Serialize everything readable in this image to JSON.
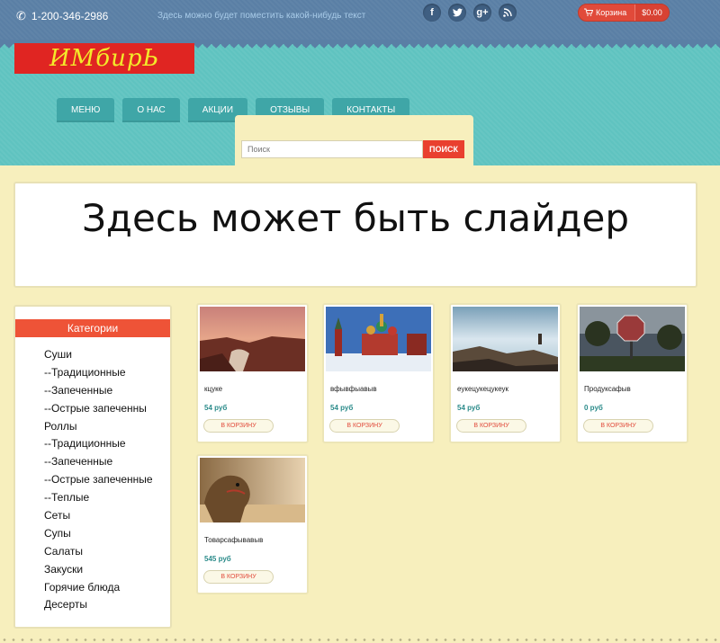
{
  "header": {
    "phone": "1-200-346-2986",
    "tagline": "Здесь можно будет поместить какой-нибудь текст",
    "cart_label": "Корзина",
    "cart_total": "$0.00",
    "socials": [
      "f",
      "t",
      "g+",
      "rss"
    ]
  },
  "logo": {
    "text": "ИМбирЬ"
  },
  "nav": {
    "items": [
      "МЕНЮ",
      "О НАС",
      "АКЦИИ",
      "ОТЗЫВЫ",
      "КОНТАКТЫ"
    ]
  },
  "search": {
    "placeholder": "Поиск",
    "button_label": "ПОИСК"
  },
  "slider": {
    "text": "Здесь может быть слайдер"
  },
  "sidebar": {
    "title": "Категории",
    "categories": [
      "Суши",
      "--Традиционные",
      "--Запеченные",
      "--Острые запеченны",
      "Роллы",
      "--Традиционные",
      "--Запеченные",
      "--Острые запеченные",
      "--Теплые",
      "Сеты",
      "Супы",
      "Салаты",
      "Закуски",
      "Горячие блюда",
      "Десерты"
    ]
  },
  "products": [
    {
      "name": "кцуке",
      "price": "54 руб",
      "button": "В КОРЗИНУ",
      "image": "canyon-sunset"
    },
    {
      "name": "вфывфыавыв",
      "price": "54 руб",
      "button": "В КОРЗИНУ",
      "image": "kremlin"
    },
    {
      "name": "еукецукецукеук",
      "price": "54 руб",
      "button": "В КОРЗИНУ",
      "image": "seascape-rocks"
    },
    {
      "name": "Продуксафыв",
      "price": "0 руб",
      "button": "В КОРЗИНУ",
      "image": "stop-sign"
    },
    {
      "name": "Товарсафывавыв",
      "price": "545 руб",
      "button": "В КОРЗИНУ",
      "image": "camel"
    }
  ],
  "colors": {
    "topbar": "#5a7fa5",
    "teal": "#5fc3c0",
    "accent": "#e9402f",
    "page_bg": "#f7efbd",
    "price": "#2b8b8a"
  }
}
